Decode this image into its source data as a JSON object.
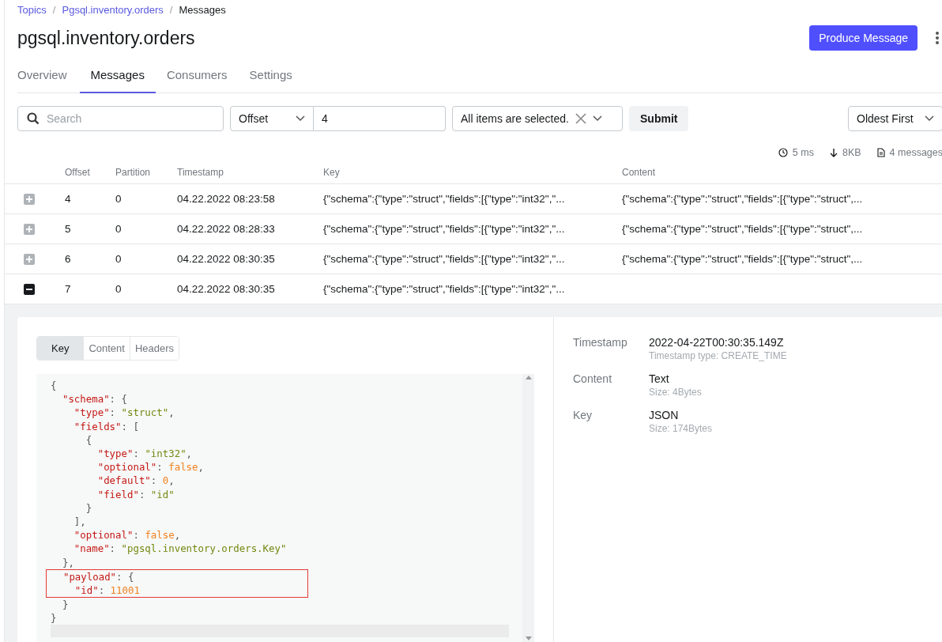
{
  "breadcrumbs": [
    {
      "label": "Topics",
      "link": true
    },
    {
      "separator": "/"
    },
    {
      "label": "Pgsql.inventory.orders",
      "link": true
    },
    {
      "separator": "/"
    },
    {
      "label": "Messages",
      "link": false
    }
  ],
  "title": "pgsql.inventory.orders",
  "produce_button": "Produce Message",
  "tabs": [
    {
      "label": "Overview",
      "selected": false
    },
    {
      "label": "Messages",
      "selected": true
    },
    {
      "label": "Consumers",
      "selected": false
    },
    {
      "label": "Settings",
      "selected": false
    }
  ],
  "filters": {
    "search": {
      "placeholder": "Search"
    },
    "seek_type": "Offset",
    "seek_value": "4",
    "partitions": "All items are selected.",
    "submit": "Submit",
    "order": "Oldest First"
  },
  "stats": [
    {
      "kind": "time",
      "text": "5 ms"
    },
    {
      "kind": "size",
      "text": "8KB"
    },
    {
      "kind": "count",
      "text": "4 messages"
    }
  ],
  "table": {
    "columns": [
      "Offset",
      "Partition",
      "Timestamp",
      "Key",
      "Content"
    ],
    "rows": [
      {
        "expanded": false,
        "cells": [
          "4",
          "0",
          "04.22.2022 08:23:58",
          "{\"schema\":{\"type\":\"struct\",\"fields\":[{\"type\":\"int32\",\"...",
          "{\"schema\":{\"type\":\"struct\",\"fields\":[{\"type\":\"struct\",..."
        ]
      },
      {
        "expanded": false,
        "cells": [
          "5",
          "0",
          "04.22.2022 08:28:33",
          "{\"schema\":{\"type\":\"struct\",\"fields\":[{\"type\":\"int32\",\"...",
          "{\"schema\":{\"type\":\"struct\",\"fields\":[{\"type\":\"struct\",..."
        ]
      },
      {
        "expanded": false,
        "cells": [
          "6",
          "0",
          "04.22.2022 08:30:35",
          "{\"schema\":{\"type\":\"struct\",\"fields\":[{\"type\":\"int32\",\"...",
          "{\"schema\":{\"type\":\"struct\",\"fields\":[{\"type\":\"struct\",..."
        ]
      },
      {
        "expanded": true,
        "cells": [
          "7",
          "0",
          "04.22.2022 08:30:35",
          "{\"schema\":{\"type\":\"struct\",\"fields\":[{\"type\":\"int32\",\"..."
        ]
      }
    ]
  },
  "detail": {
    "tabs": [
      {
        "label": "Key",
        "selected": true
      },
      {
        "label": "Content",
        "selected": false
      },
      {
        "label": "Headers",
        "selected": false
      }
    ],
    "code": [
      {
        "text": "{",
        "highlighted": false
      },
      {
        "text": "  \"schema\": {",
        "highlighted": false
      },
      {
        "text": "    \"type\": \"struct\",",
        "highlighted": false
      },
      {
        "text": "    \"fields\": [",
        "highlighted": false
      },
      {
        "text": "      {",
        "highlighted": false
      },
      {
        "text": "        \"type\": \"int32\",",
        "highlighted": false
      },
      {
        "text": "        \"optional\": false,",
        "highlighted": false
      },
      {
        "text": "        \"default\": 0,",
        "highlighted": false
      },
      {
        "text": "        \"field\": \"id\"",
        "highlighted": false
      },
      {
        "text": "      }",
        "highlighted": false
      },
      {
        "text": "    ],",
        "highlighted": false
      },
      {
        "text": "    \"optional\": false,",
        "highlighted": false
      },
      {
        "text": "    \"name\": \"pgsql.inventory.orders.Key\"",
        "highlighted": false
      },
      {
        "text": "  },",
        "highlighted": false
      },
      {
        "text": "  \"payload\": {",
        "highlighted": true
      },
      {
        "text": "    \"id\": 11001",
        "highlighted": true
      },
      {
        "text": "  }",
        "highlighted": false
      },
      {
        "text": "}",
        "highlighted": false
      }
    ],
    "meta": [
      {
        "label": "Timestamp",
        "value": "2022-04-22T00:30:35.149Z",
        "sub": "Timestamp type: CREATE_TIME"
      },
      {
        "label": "Content",
        "value": "Text",
        "sub": "Size: 4Bytes"
      },
      {
        "label": "Key",
        "value": "JSON",
        "sub": "Size: 174Bytes"
      }
    ]
  }
}
